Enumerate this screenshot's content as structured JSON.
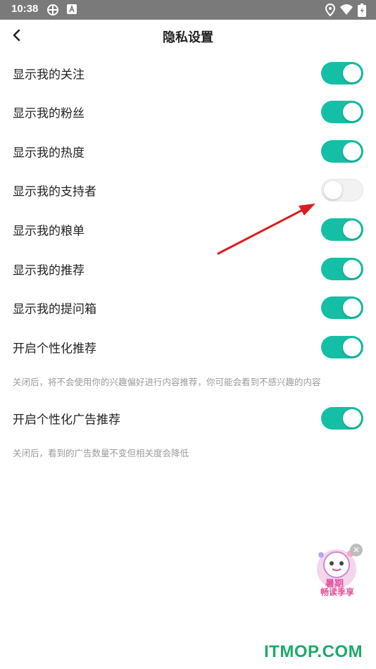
{
  "status_bar": {
    "time": "10:38"
  },
  "header": {
    "title": "隐私设置"
  },
  "settings": [
    {
      "label": "显示我的关注",
      "enabled": true
    },
    {
      "label": "显示我的粉丝",
      "enabled": true
    },
    {
      "label": "显示我的热度",
      "enabled": true
    },
    {
      "label": "显示我的支持者",
      "enabled": false
    },
    {
      "label": "显示我的粮单",
      "enabled": true
    },
    {
      "label": "显示我的推荐",
      "enabled": true
    },
    {
      "label": "显示我的提问箱",
      "enabled": true
    },
    {
      "label": "开启个性化推荐",
      "enabled": true
    },
    {
      "label": "开启个性化广告推荐",
      "enabled": true
    }
  ],
  "descriptions": {
    "personalized": "关闭后，将不会使用你的兴趣偏好进行内容推荐，你可能会看到不感兴趣的内容",
    "ads": "关闭后，看到的广告数量不变但相关度会降低"
  },
  "promo": {
    "line1": "暑期",
    "line2": "畅读季享"
  },
  "watermark": "ITMOP.COM",
  "colors": {
    "toggle_on": "#14bfa5",
    "toggle_off": "#f2f2f2",
    "annotation_arrow": "#d81f1f"
  },
  "icons": [
    "back-icon",
    "location-icon",
    "wifi-icon",
    "battery-icon",
    "close-icon"
  ]
}
